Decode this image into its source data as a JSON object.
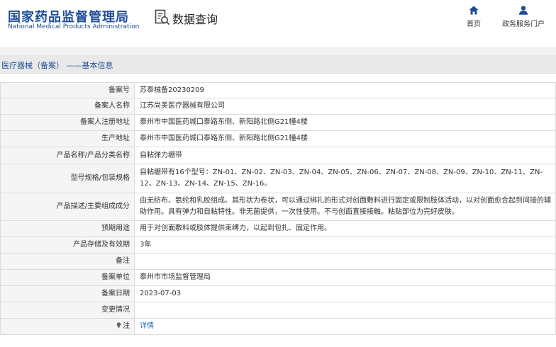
{
  "header": {
    "logo_cn": "国家药品监督管理局",
    "logo_en": "National Medical Products Administration",
    "section_title": "数据查询",
    "nav": [
      {
        "label": "首页",
        "icon": "home-icon"
      },
      {
        "label": "政务服务门户",
        "icon": "user-icon"
      }
    ]
  },
  "breadcrumb": "医疗器械（备案） ——基本信息",
  "colors": {
    "brand": "#1f4e97",
    "link": "#1f6fb8",
    "label_bg": "#f5f5f5",
    "border": "#dcdcdc"
  },
  "rows": [
    {
      "label": "备案号",
      "value": "苏泰械备20230209"
    },
    {
      "label": "备案人名称",
      "value": "江苏尚美医疗器械有限公司"
    },
    {
      "label": "备案人注册地址",
      "value": "泰州市中国医药城口泰路东侧、新阳路北侧G21幢4楼"
    },
    {
      "label": "生产地址",
      "value": "泰州市中国医药城口泰路东侧、新阳路北侧G21幢4楼"
    },
    {
      "label": "产品名称/产品分类名称",
      "value": "自粘弹力绷带"
    },
    {
      "label": "型号规格/包装规格",
      "value": "自粘绷带有16个型号：ZN-01、ZN-02、ZN-03、ZN-04、ZN-05、ZN-06、ZN-07、ZN-08、ZN-09、ZN-10、ZN-11、ZN-12、ZN-13、ZN-14、ZN-15、ZN-16。"
    },
    {
      "label": "产品描述/主要组成成分",
      "value": "由无纺布、氨纶和乳胶组成。其形状为卷状，可以通过绑扎的形式对创面敷料进行固定或限制肢体活动，以对创面愈合起到间接的辅助作用。具有弹力和自粘特性。非无菌提供，一次性使用。不与创面直接接触。粘贴部位为完好皮肤。"
    },
    {
      "label": "预期用途",
      "value": "用于对创面敷料或肢体提供束缚力，以起到包扎、固定作用。"
    },
    {
      "label": "产品存储及有效期",
      "value": "3年"
    },
    {
      "label": "备注",
      "value": ""
    },
    {
      "label": "备案单位",
      "value": "泰州市市场监督管理局"
    },
    {
      "label": "备案日期",
      "value": "2023-07-03"
    },
    {
      "label": "变更情况",
      "value": ""
    },
    {
      "label": "注",
      "value": "详情",
      "icon": "pin-icon"
    }
  ]
}
